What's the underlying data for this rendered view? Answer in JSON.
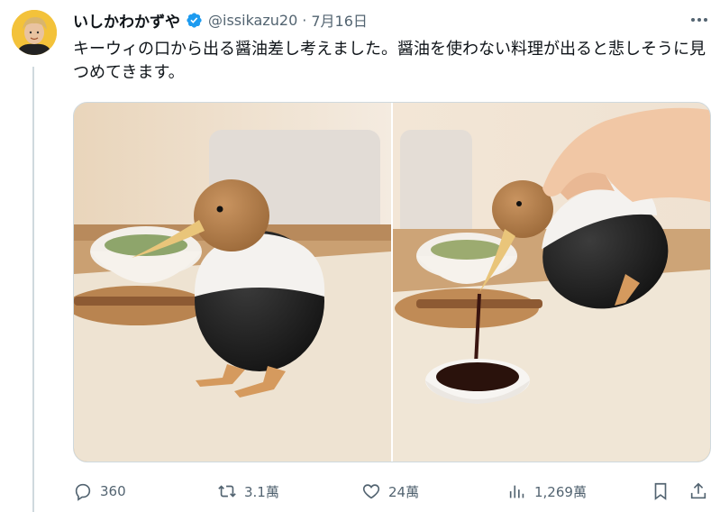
{
  "tweet": {
    "display_name": "いしかわかずや",
    "handle": "@issikazu20",
    "separator": "·",
    "date": "7月16日",
    "text": "キーウィの口から出る醤油差し考えました。醤油を使わない料理が出ると悲しそうに見つめてきます。"
  },
  "actions": {
    "replies": "360",
    "retweets": "3.1萬",
    "likes": "24萬",
    "views": "1,269萬"
  },
  "icons": {
    "verified": "verified-badge-icon",
    "more": "more-icon",
    "reply": "reply-icon",
    "retweet": "retweet-icon",
    "like": "like-icon",
    "views": "views-icon",
    "bookmark": "bookmark-icon",
    "share": "share-icon"
  },
  "colors": {
    "verified_blue": "#1d9bf0",
    "secondary_text": "#536471",
    "primary_text": "#0f1419"
  }
}
